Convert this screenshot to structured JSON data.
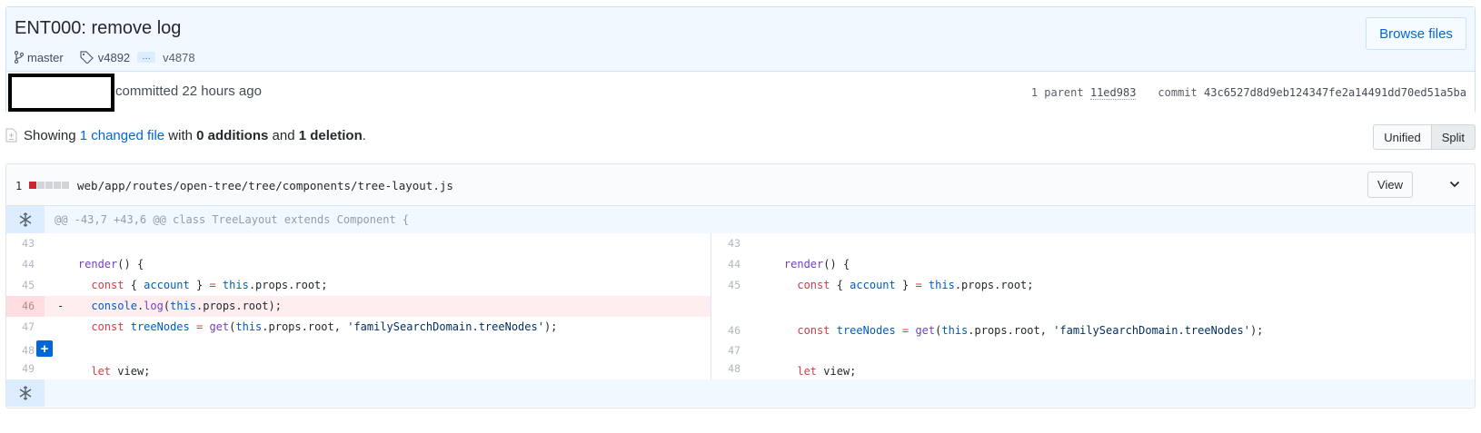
{
  "commit": {
    "title": "ENT000: remove log",
    "branch": "master",
    "tag": "v4892",
    "ellipsis": "…",
    "tag_end": "v4878",
    "browse_label": "Browse files",
    "committed_text": "committed 22 hours ago",
    "parent_label": "1 parent",
    "parent_sha": "11ed983",
    "commit_label": "commit",
    "commit_sha": "43c6527d8d9eb124347fe2a14491dd70ed51a5ba"
  },
  "toc": {
    "showing": "Showing",
    "changed_files": "1 changed file",
    "with": "with",
    "additions": "0 additions",
    "and": "and",
    "deletions": "1 deletion",
    "period": "."
  },
  "view_toggle": {
    "unified": "Unified",
    "split": "Split",
    "selected": "Split"
  },
  "file": {
    "change_count": "1",
    "diffstat": [
      "deleted",
      "neutral",
      "neutral",
      "neutral",
      "neutral"
    ],
    "path": "web/app/routes/open-tree/tree/components/tree-layout.js",
    "view_label": "View",
    "hunk_header": "@@ -43,7 +43,6 @@ class TreeLayout extends Component {"
  },
  "rows": [
    {
      "left_num": "43",
      "right_num": "43",
      "left_type": "context",
      "right_type": "context"
    },
    {
      "left_num": "44",
      "right_num": "44",
      "left_type": "context",
      "right_type": "context"
    },
    {
      "left_num": "45",
      "right_num": "45",
      "left_type": "context",
      "right_type": "context"
    },
    {
      "left_num": "46",
      "right_num": "",
      "left_type": "deletion",
      "right_type": "empty",
      "marker": "-"
    },
    {
      "left_num": "47",
      "right_num": "46",
      "left_type": "context",
      "right_type": "context"
    },
    {
      "left_num": "48",
      "right_num": "47",
      "left_type": "context",
      "right_type": "context",
      "add_button": "+"
    },
    {
      "left_num": "49",
      "right_num": "48",
      "left_type": "context",
      "right_type": "context"
    }
  ],
  "colors": {
    "header_bg": "#f1f8ff",
    "link": "#0366d6",
    "deletion_bg": "#ffeef0",
    "deletion_num_bg": "#ffdce0",
    "diffstat_deleted": "#cb2431",
    "keyword": "#d73a49",
    "function": "#6f42c1",
    "constant": "#005cc5",
    "string": "#032f62"
  },
  "icons": [
    "git-branch-icon",
    "tag-icon",
    "file-diff-icon",
    "chevron-down-icon",
    "unfold-icon",
    "plus-icon"
  ]
}
